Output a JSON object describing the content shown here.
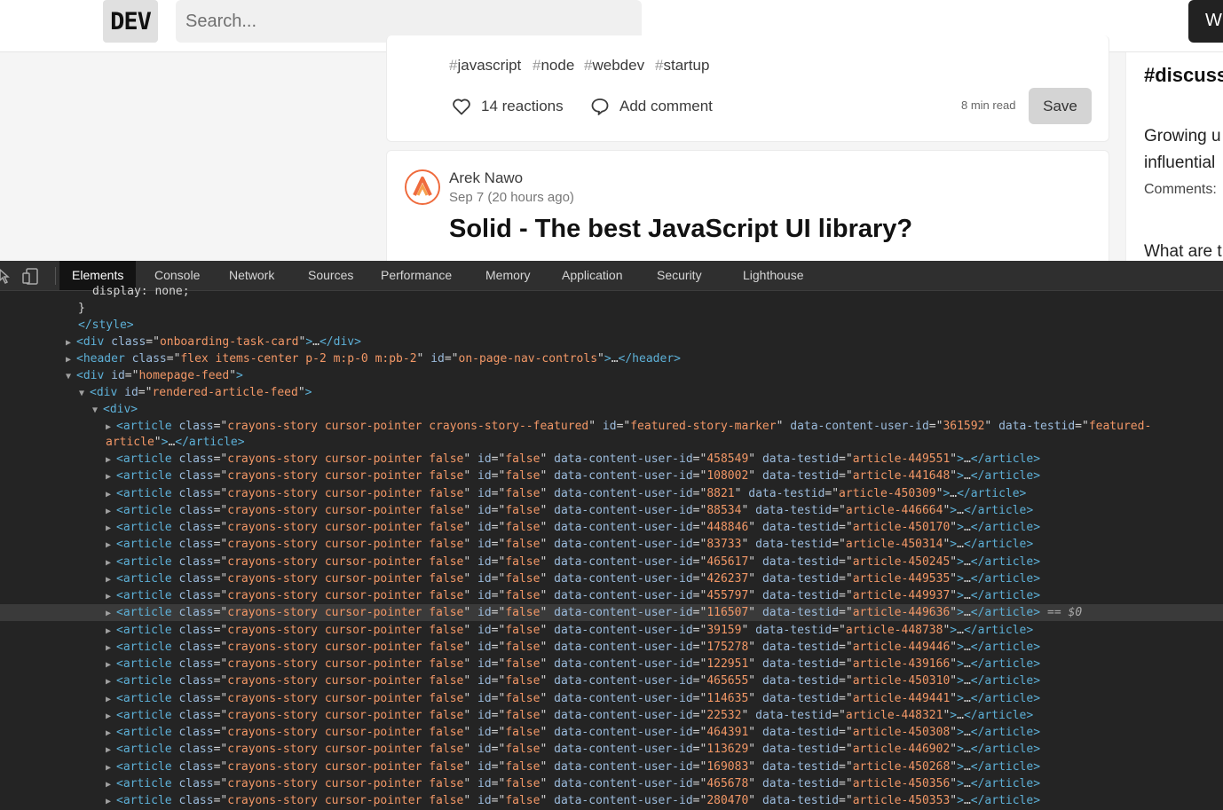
{
  "header": {
    "logo": "DEV",
    "search_placeholder": "Search...",
    "write_label": "W"
  },
  "card1": {
    "tags": [
      "javascript",
      "node",
      "webdev",
      "startup"
    ],
    "reactions": "14 reactions",
    "comments": "Add comment",
    "read_time": "8 min read",
    "save_label": "Save"
  },
  "card2": {
    "author": "Arek Nawo",
    "date": "Sep 7 (20 hours ago)",
    "title": "Solid - The best JavaScript UI library?"
  },
  "sidebar": {
    "heading": "#discuss",
    "text1_line1": "Growing u",
    "text1_line2": "influential",
    "comments": "Comments:",
    "text2": "What are t"
  },
  "devtools": {
    "tabs": [
      "Elements",
      "Console",
      "Network",
      "Sources",
      "Performance",
      "Memory",
      "Application",
      "Security",
      "Lighthouse"
    ],
    "active_tab": "Elements",
    "lines_before": [
      "display: none;",
      "}",
      "</style>"
    ],
    "onboarding": {
      "tag": "div",
      "attr": "class",
      "value": "onboarding-task-card"
    },
    "header": {
      "class": "flex items-center p-2 m:p-0 m:pb-2",
      "id": "on-page-nav-controls"
    },
    "homepage_feed_id": "homepage-feed",
    "rendered_feed_id": "rendered-article-feed",
    "featured": {
      "class": "crayons-story cursor-pointer crayons-story--featured",
      "id": "featured-story-marker",
      "user_id": "361592",
      "testid_part1": "featured-",
      "testid_part2": "article"
    },
    "article_class": "crayons-story cursor-pointer false",
    "article_id": "false",
    "selected_marker": "== $0",
    "articles": [
      {
        "user": "458549",
        "testid": "article-449551"
      },
      {
        "user": "108002",
        "testid": "article-441648"
      },
      {
        "user": "8821",
        "testid": "article-450309"
      },
      {
        "user": "88534",
        "testid": "article-446664"
      },
      {
        "user": "448846",
        "testid": "article-450170"
      },
      {
        "user": "83733",
        "testid": "article-450314"
      },
      {
        "user": "465617",
        "testid": "article-450245"
      },
      {
        "user": "426237",
        "testid": "article-449535"
      },
      {
        "user": "455797",
        "testid": "article-449937"
      },
      {
        "user": "116507",
        "testid": "article-449636",
        "selected": true
      },
      {
        "user": "39159",
        "testid": "article-448738"
      },
      {
        "user": "175278",
        "testid": "article-449446"
      },
      {
        "user": "122951",
        "testid": "article-439166"
      },
      {
        "user": "465655",
        "testid": "article-450310"
      },
      {
        "user": "114635",
        "testid": "article-449441"
      },
      {
        "user": "22532",
        "testid": "article-448321"
      },
      {
        "user": "464391",
        "testid": "article-450308"
      },
      {
        "user": "113629",
        "testid": "article-446902"
      },
      {
        "user": "169083",
        "testid": "article-450268"
      },
      {
        "user": "465678",
        "testid": "article-450356"
      },
      {
        "user": "280470",
        "testid": "article-450353"
      }
    ]
  }
}
